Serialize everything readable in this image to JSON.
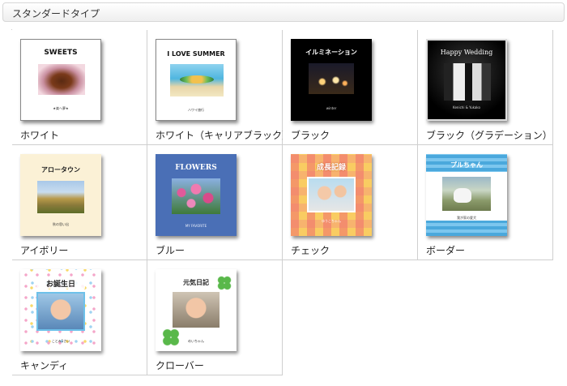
{
  "header": {
    "title": "スタンダードタイプ"
  },
  "items": [
    {
      "label": "ホワイト",
      "cover_title": "SWEETS",
      "cover_caption": "★楽へ夢★"
    },
    {
      "label": "ホワイト（キャリアブラック）",
      "cover_title": "I LOVE SUMMER",
      "cover_caption": "ハワイ旅行"
    },
    {
      "label": "ブラック",
      "cover_title": "イルミネーション",
      "cover_caption": "winter"
    },
    {
      "label": "ブラック（グラデーション）",
      "cover_title": "Happy Wedding",
      "cover_caption": "Kenichi & Yukako"
    },
    {
      "label": "アイボリー",
      "cover_title": "アロータウン",
      "cover_caption": "秋の思い出"
    },
    {
      "label": "ブルー",
      "cover_title": "FLOWERS",
      "cover_caption": "MY FAVORITE"
    },
    {
      "label": "チェック",
      "cover_title": "成長記録",
      "cover_caption": "ゆうこちゃん"
    },
    {
      "label": "ボーダー",
      "cover_title": "プルちゃん",
      "cover_caption": "我が家の愛犬"
    },
    {
      "label": "キャンディ",
      "cover_title": "お誕生日",
      "cover_caption": "ことみ1さい"
    },
    {
      "label": "クローバー",
      "cover_title": "元気日記",
      "cover_caption": "めいちゃん"
    }
  ]
}
